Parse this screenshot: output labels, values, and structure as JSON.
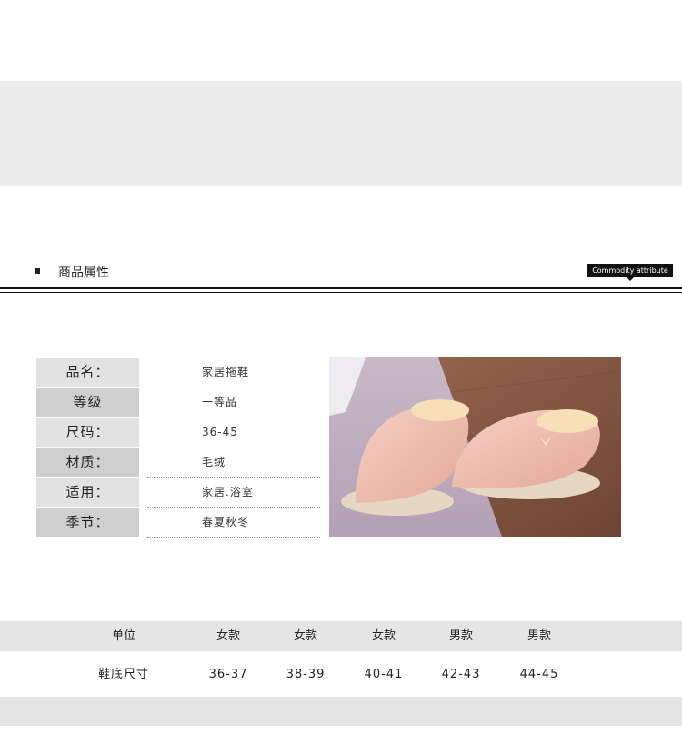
{
  "section": {
    "title": "商品属性",
    "tag": "Commodity attribute"
  },
  "attributes": [
    {
      "key": "品名：",
      "value": "家居拖鞋"
    },
    {
      "key": "等级",
      "value": "一等品"
    },
    {
      "key": "尺码：",
      "value": "36-45"
    },
    {
      "key": "材质：",
      "value": "毛绒"
    },
    {
      "key": "适用：",
      "value": "家居.浴室"
    },
    {
      "key": "季节：",
      "value": "春夏秋冬"
    }
  ],
  "size_table": {
    "header": [
      "单位",
      "女款",
      "女款",
      "女款",
      "男款",
      "男款"
    ],
    "row": [
      "鞋底尺寸",
      "36-37",
      "38-39",
      "40-41",
      "42-43",
      "44-45"
    ]
  },
  "colors": {
    "band": "#ececec",
    "key_light": "#e2e2e2",
    "key_dark": "#cfcfcf",
    "slipper": "#f0c2b4",
    "floor": "#8a5a44"
  }
}
